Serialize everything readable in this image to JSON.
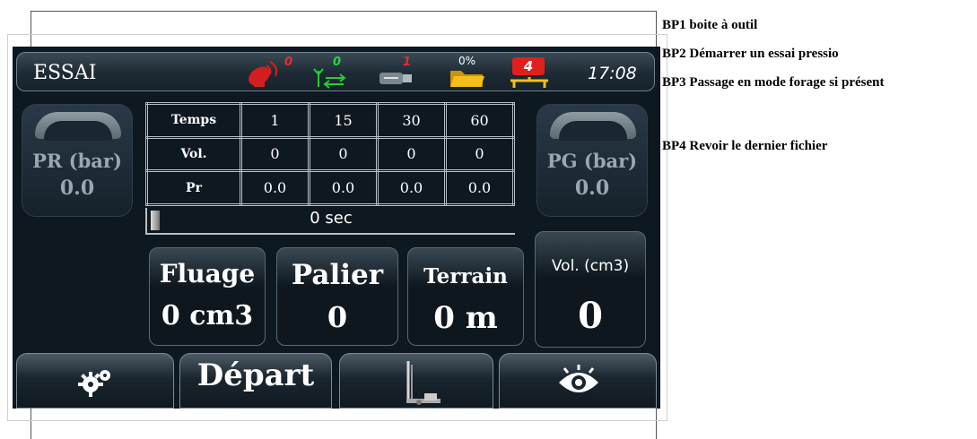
{
  "notes": [
    "BP1 boite à outil",
    "BP2 Démarrer un essai pressio",
    "BP3 Passage en mode forage si présent",
    "BP4 Revoir le dernier fichier"
  ],
  "header": {
    "title": "ESSAI",
    "time": "17:08",
    "indicators": {
      "satellite": "0",
      "antenna": "0",
      "usb": "1",
      "folder": "0%",
      "device": "4"
    }
  },
  "gauges": {
    "pr": {
      "label": "PR (bar)",
      "value": "0.0"
    },
    "pg": {
      "label": "PG (bar)",
      "value": "0.0"
    }
  },
  "table": {
    "rows": [
      [
        "Temps",
        "1",
        "15",
        "30",
        "60"
      ],
      [
        "Vol.",
        "0",
        "0",
        "0",
        "0"
      ],
      [
        "Pr",
        "0.0",
        "0.0",
        "0.0",
        "0.0"
      ]
    ]
  },
  "progress": {
    "text": "0 sec",
    "fraction": 0.02
  },
  "cards": {
    "fluage": {
      "label": "Fluage",
      "value": "0 cm3"
    },
    "palier": {
      "label": "Palier",
      "value": "0"
    },
    "terrain": {
      "label": "Terrain",
      "value": "0 m"
    },
    "volume": {
      "label": "Vol. (cm3)",
      "value": "0"
    }
  },
  "buttons": {
    "start_label": "Départ"
  },
  "icons": [
    "gears-icon",
    "drilling-rig-icon",
    "eye-icon",
    "satellite-icon",
    "antenna-icon",
    "usb-icon",
    "folder-icon",
    "device-icon"
  ],
  "colors": {
    "screen_bg": "#0e1820",
    "satellite_red": "#d41f1f",
    "antenna_green": "#22d12e",
    "device_red": "#e0201f",
    "folder_yellow": "#f4c016"
  }
}
